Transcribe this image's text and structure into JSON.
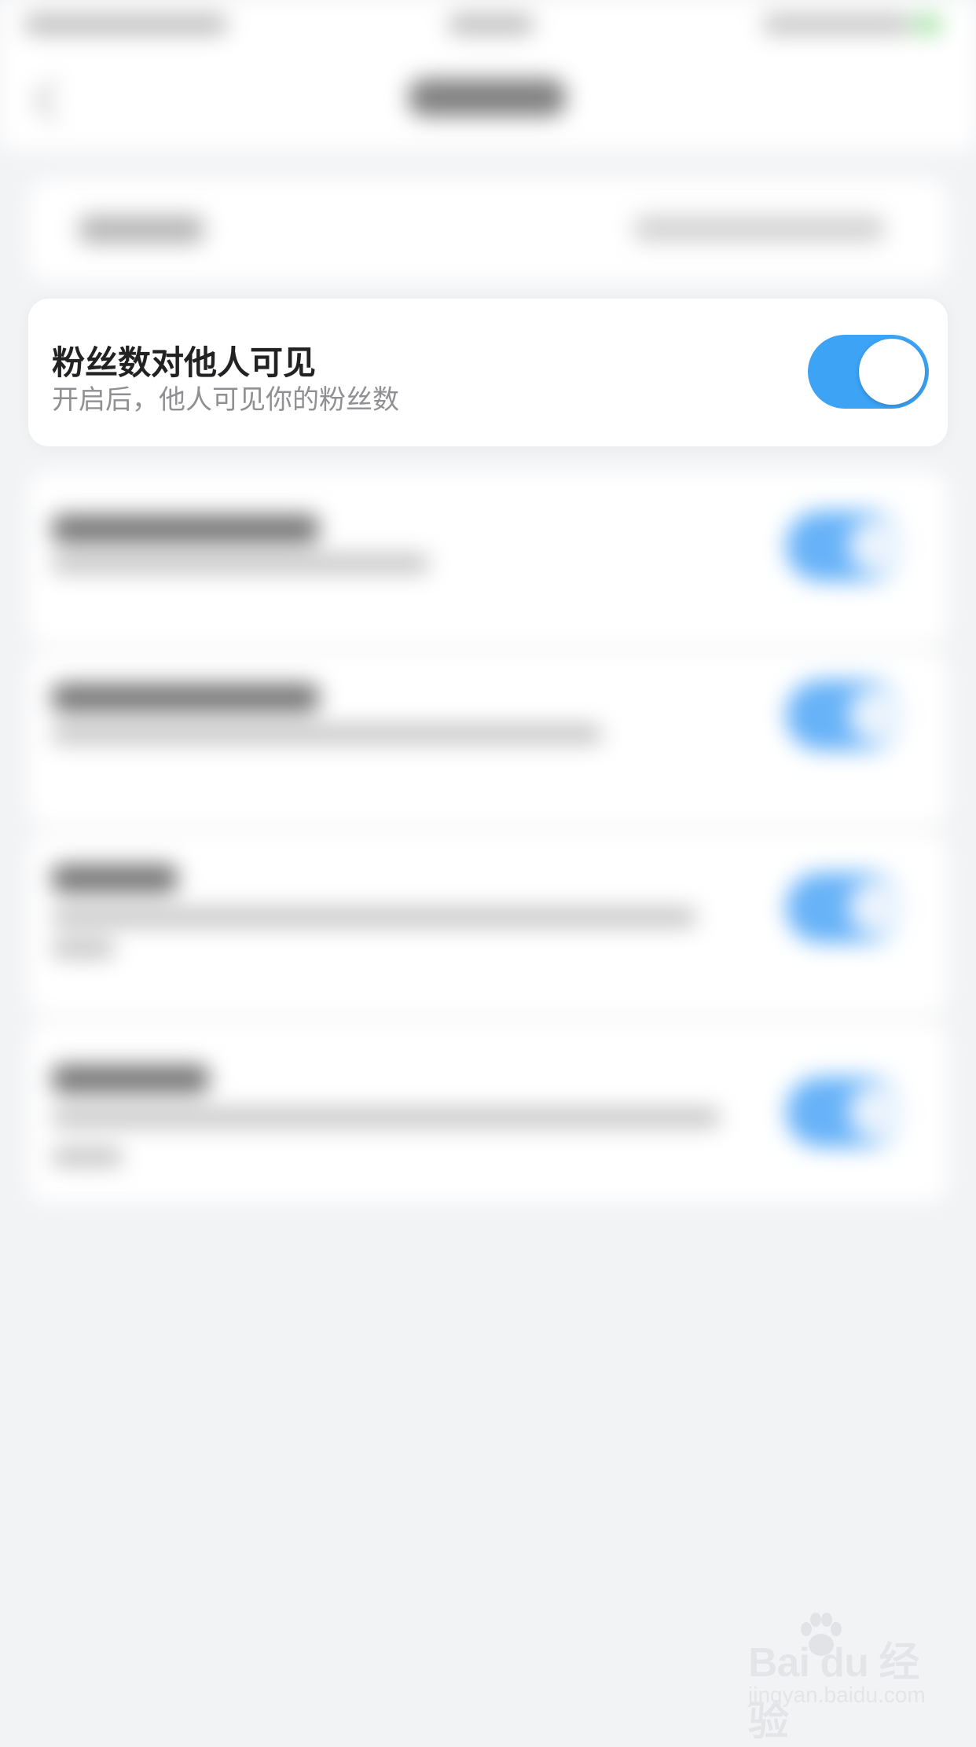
{
  "privacy_setting": {
    "title": "粉丝数对他人可见",
    "subtitle": "开启后，他人可见你的粉丝数",
    "enabled": true,
    "accent_color": "#3da3f5"
  },
  "watermark": {
    "brand": "Bai du 经验",
    "domain": "jingyan.baidu.com"
  }
}
